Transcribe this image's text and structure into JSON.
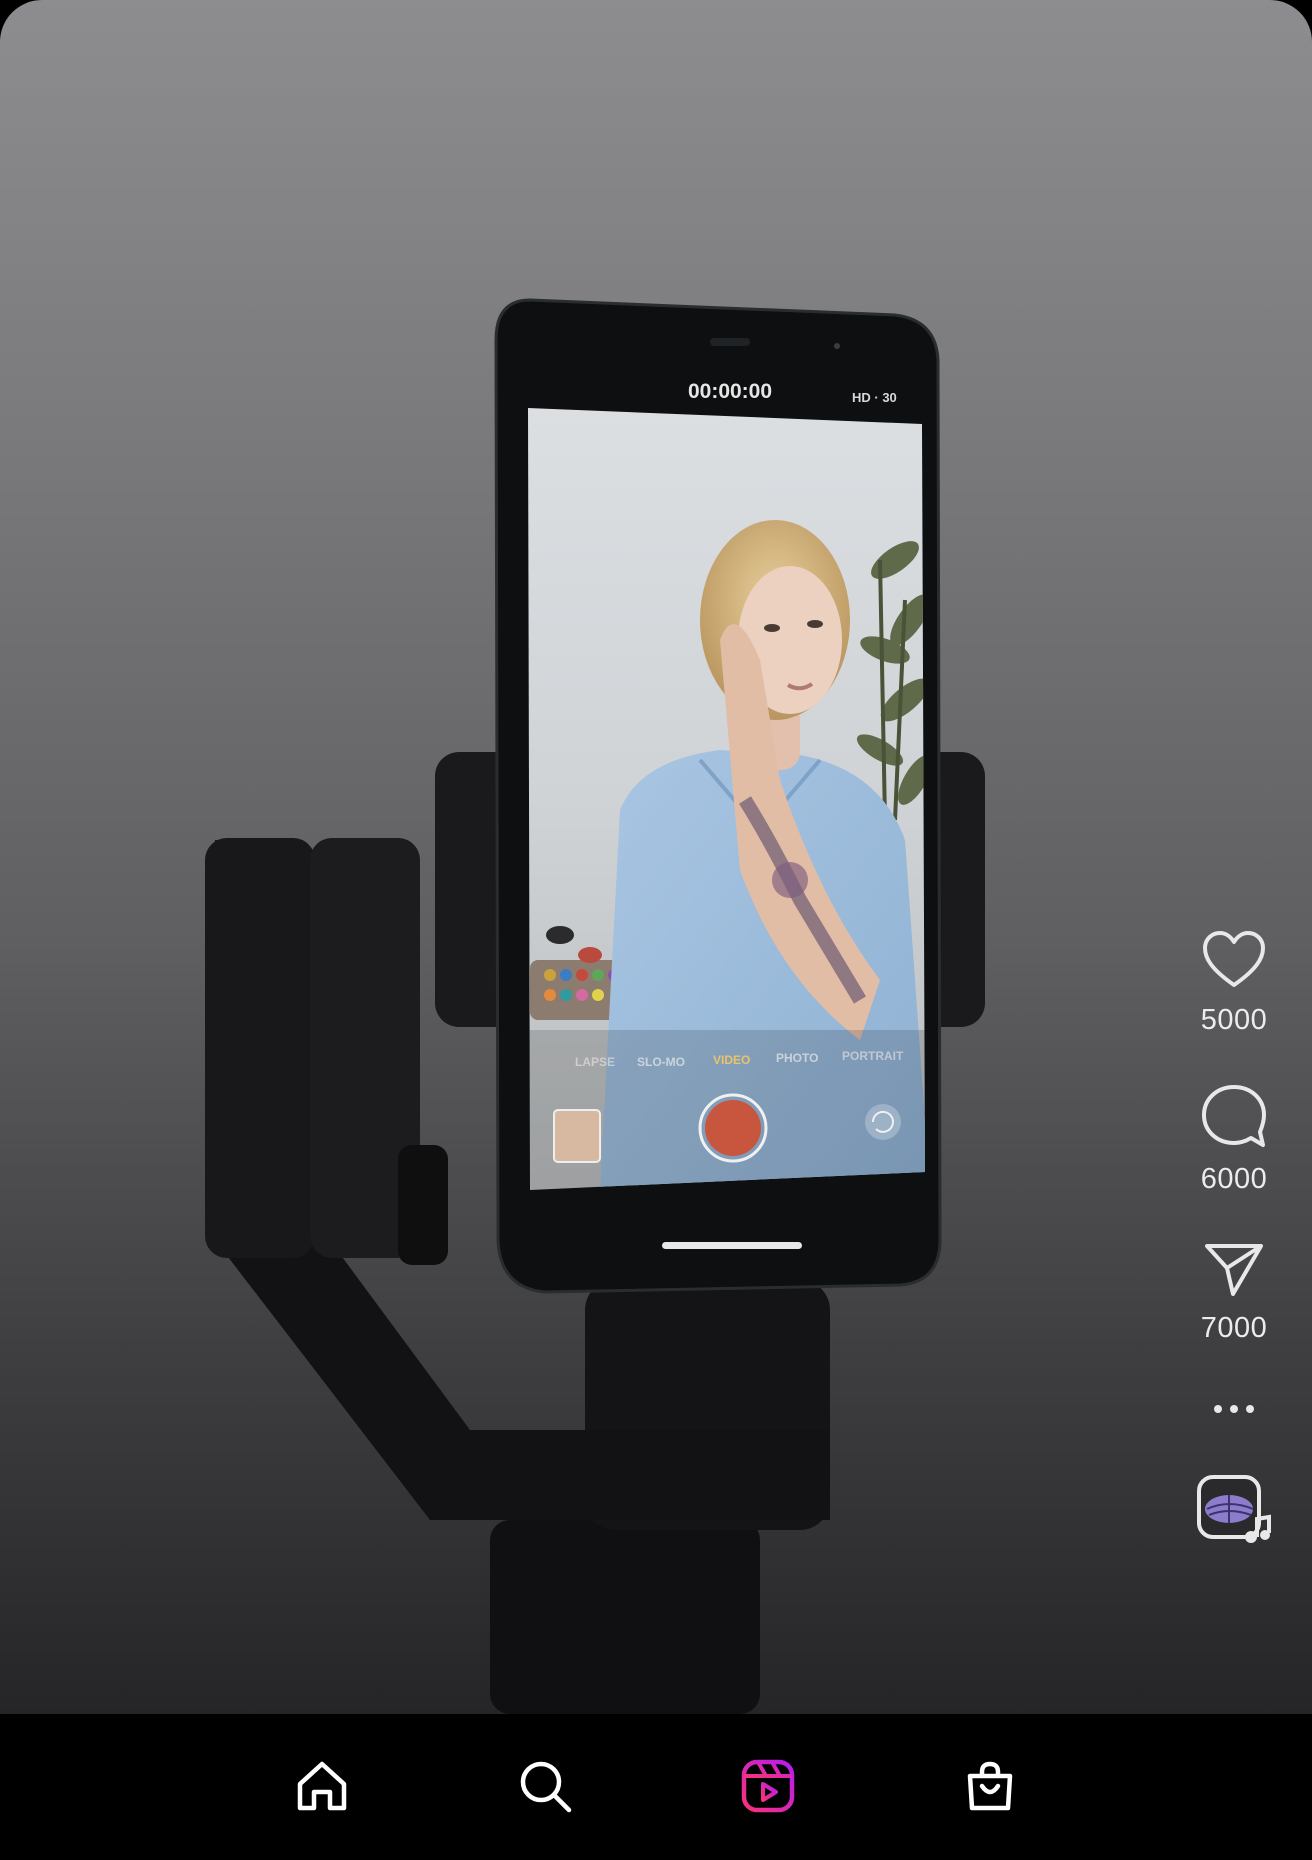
{
  "video": {
    "camera_timer": "00:00:00",
    "camera_format": "HD · 30",
    "camera_modes": [
      "LAPSE",
      "SLO-MO",
      "VIDEO",
      "PHOTO",
      "PORTRAIT"
    ],
    "active_mode_color": "#e9c46a"
  },
  "actions": {
    "like": {
      "icon": "heart-icon",
      "count": "5000"
    },
    "comment": {
      "icon": "comment-icon",
      "count": "6000"
    },
    "share": {
      "icon": "send-icon",
      "count": "7000"
    },
    "more": {
      "icon": "more-icon"
    },
    "audio": {
      "icon": "audio-track-icon"
    }
  },
  "nav": {
    "items": [
      {
        "icon": "home-icon"
      },
      {
        "icon": "search-icon"
      },
      {
        "icon": "reels-icon",
        "active": true
      },
      {
        "icon": "shop-icon"
      }
    ],
    "active_gradient": [
      "#f9327a",
      "#b51cf0"
    ]
  }
}
